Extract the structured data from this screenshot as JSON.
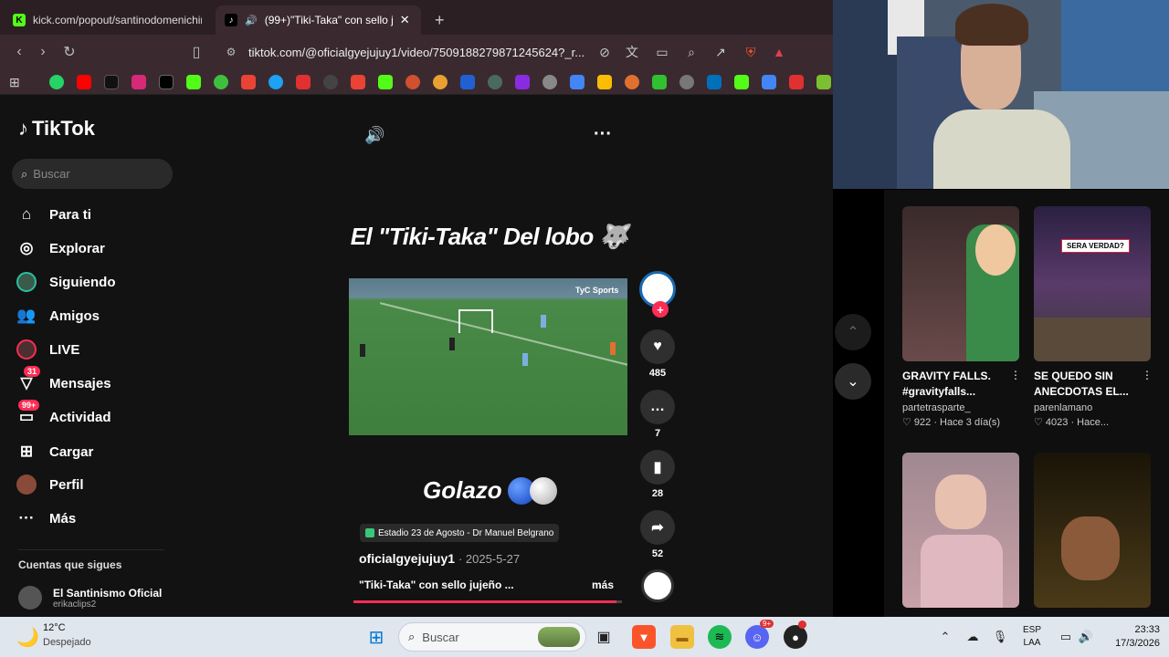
{
  "browser": {
    "tabs": [
      {
        "label": "kick.com/popout/santinodomenichin"
      },
      {
        "label": "(99+)\"Tiki-Taka\" con sello juje"
      }
    ],
    "url": "tiktok.com/@oficialgyejujuy1/video/7509188279871245624?_r..."
  },
  "tiktok": {
    "logo": "TikTok",
    "search_placeholder": "Buscar",
    "nav": [
      {
        "label": "Para ti",
        "icon": "home-icon"
      },
      {
        "label": "Explorar",
        "icon": "compass-icon"
      },
      {
        "label": "Siguiendo",
        "icon": "following-icon"
      },
      {
        "label": "Amigos",
        "icon": "friends-icon"
      },
      {
        "label": "LIVE",
        "icon": "live-icon"
      },
      {
        "label": "Mensajes",
        "icon": "messages-icon",
        "badge": "31"
      },
      {
        "label": "Actividad",
        "icon": "activity-icon",
        "badge": "99+"
      },
      {
        "label": "Cargar",
        "icon": "upload-icon"
      },
      {
        "label": "Perfil",
        "icon": "profile-icon"
      },
      {
        "label": "Más",
        "icon": "more-icon"
      }
    ],
    "following_header": "Cuentas que sigues",
    "following": [
      {
        "name": "El Santinismo Oficial",
        "handle": "erikaclips2"
      }
    ],
    "video": {
      "caption_top": "El \"Tiki-Taka\" Del lobo 🐺",
      "caption_bottom": "Golazo",
      "location": "Estadio 23 de Agosto - Dr Manuel Belgrano",
      "author": "oficialgyejujuy1",
      "date": "· 2025-5-27",
      "description": "\"Tiki-Taka\" con sello jujeño ...",
      "more": "más",
      "likes": "485",
      "comments": "7",
      "saves": "28",
      "shares": "52",
      "progress": 0.98
    }
  },
  "recommendations": [
    {
      "title": "GRAVITY FALLS. #gravityfalls...",
      "user": "partetrasparte_",
      "stats": "922 · Hace 3 día(s)"
    },
    {
      "title": "SE QUEDO SIN ANECDOTAS EL...",
      "user": "parenlamano",
      "stats": "4023 · Hace...",
      "overlay": "SERA VERDAD?"
    },
    {
      "title": "",
      "user": "",
      "stats": ""
    },
    {
      "title": "",
      "user": "",
      "stats": ""
    }
  ],
  "taskbar": {
    "weather_temp": "12°C",
    "weather_desc": "Despejado",
    "search": "Buscar",
    "lang1": "ESP",
    "lang2": "LAA",
    "time": "23:33",
    "date": "17/3/2026",
    "discord_badge": "9+"
  }
}
